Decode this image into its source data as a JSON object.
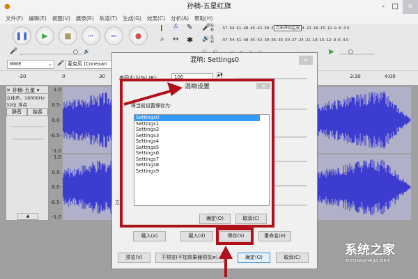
{
  "window": {
    "title": "孙楠-五星红旗",
    "min": "-",
    "max": "□",
    "close": "×"
  },
  "menu": [
    "文件(F)",
    "编辑(E)",
    "视图(V)",
    "摄录(R)",
    "轨道(T)",
    "生成(G)",
    "效果(C)",
    "分析(A)",
    "帮助(H)"
  ],
  "meter": {
    "record_scale": "-57 -54 -51 -48 -45 -42 -39 -3",
    "monitor_label": "点击开始监视",
    "record_scale_end": "4 -21 -18 -15 -12 -9 -6 -3 0",
    "play_scale": "-57 -54 -51 -48 -45 -42 -39 -36 -33 -30 -27 -24 -21 -18 -15 -12 -9 -6 -3 0",
    "channels": "左右"
  },
  "device": {
    "host": "MME",
    "mic": "麦克风 (Conexan"
  },
  "ruler": {
    "ticks": [
      "-30",
      "0",
      "30",
      "3:30",
      "4:00"
    ]
  },
  "track": {
    "name": "孙楠-五星",
    "info1": "立体声，16000Hz",
    "info2": "32位 浮点",
    "mute": "静音",
    "solo": "独奏",
    "scale": [
      "1.0",
      "0.5-",
      "0.0-",
      "-0.5-",
      "-1.0"
    ]
  },
  "reverb_dialog": {
    "title": "混响: Settings0",
    "room_size_label": "房间大小(%) (R):",
    "room_size_value": "100",
    "side_label": "立体",
    "load_a": "载入(a)",
    "load_d": "载入(d)",
    "save": "保存(S)",
    "rename": "重命名(e)",
    "preview": "预览(V)",
    "dry_preview": "干预览(不加效果器预览w)",
    "ok": "确定(O)",
    "cancel": "取消(C)"
  },
  "save_dialog": {
    "title": "混响设置",
    "prompt": "将当前设置保存为:",
    "items": [
      "Settings0",
      "Settings1",
      "Settings2",
      "Settings3",
      "Settings4",
      "Settings5",
      "Settings6",
      "Settings7",
      "Settings8",
      "Settings9"
    ],
    "selected": "Settings0",
    "ok": "确定(O)",
    "cancel": "取消(C)"
  },
  "watermark": {
    "brand": "系统之家",
    "url": "XITONGZHIJIA.NET"
  },
  "colors": {
    "wave": "#3c3cd0",
    "highlight": "#b0101a",
    "selection": "#3399ff"
  }
}
